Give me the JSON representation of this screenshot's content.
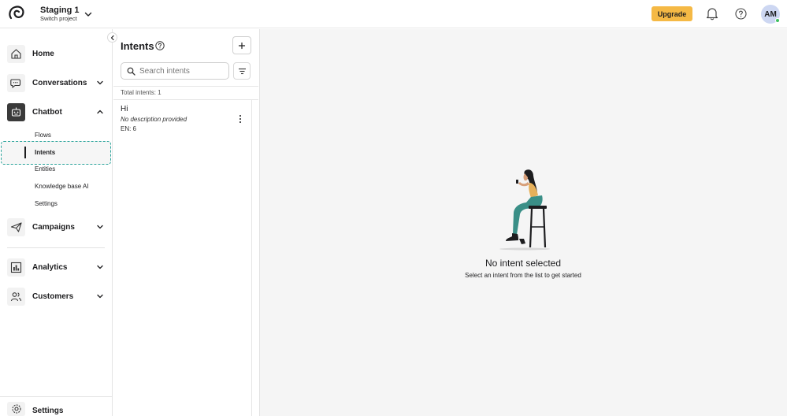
{
  "topbar": {
    "project_name": "Staging 1",
    "project_sub": "Switch project",
    "upgrade_label": "Upgrade",
    "avatar_initials": "AM",
    "icons": [
      "logo-icon",
      "chevron-down-icon",
      "bell-icon",
      "help-icon"
    ]
  },
  "sidebar": {
    "items": [
      {
        "label": "Home",
        "icon": "home-icon"
      },
      {
        "label": "Conversations",
        "icon": "chat-bubbles-icon"
      },
      {
        "label": "Chatbot",
        "icon": "robot-icon"
      },
      {
        "label": "Campaigns",
        "icon": "paper-plane-icon"
      },
      {
        "label": "Analytics",
        "icon": "bar-chart-icon"
      },
      {
        "label": "Customers",
        "icon": "users-icon"
      },
      {
        "label": "Settings",
        "icon": "gear-icon"
      }
    ],
    "chatbot_sub": [
      "Flows",
      "Intents",
      "Entities",
      "Knowledge base AI",
      "Settings"
    ],
    "active_sub": "Intents"
  },
  "intents_panel": {
    "title": "Intents",
    "search_placeholder": "Search intents",
    "search_value": "",
    "total_label": "Total intents: 1",
    "list": [
      {
        "name": "Hi",
        "description": "No description provided",
        "language": "EN: 6"
      }
    ]
  },
  "main": {
    "empty_title": "No intent selected",
    "empty_subtitle": "Select an intent from the list to get started"
  },
  "colors": {
    "accent_upgrade": "#f5b945",
    "active_icon_bg": "#3a3a3a",
    "focus_outline": "#2aa49b",
    "avatar_bg": "#cdd7f2",
    "online_dot": "#3fbf5f",
    "main_bg": "#f5f5f5"
  }
}
